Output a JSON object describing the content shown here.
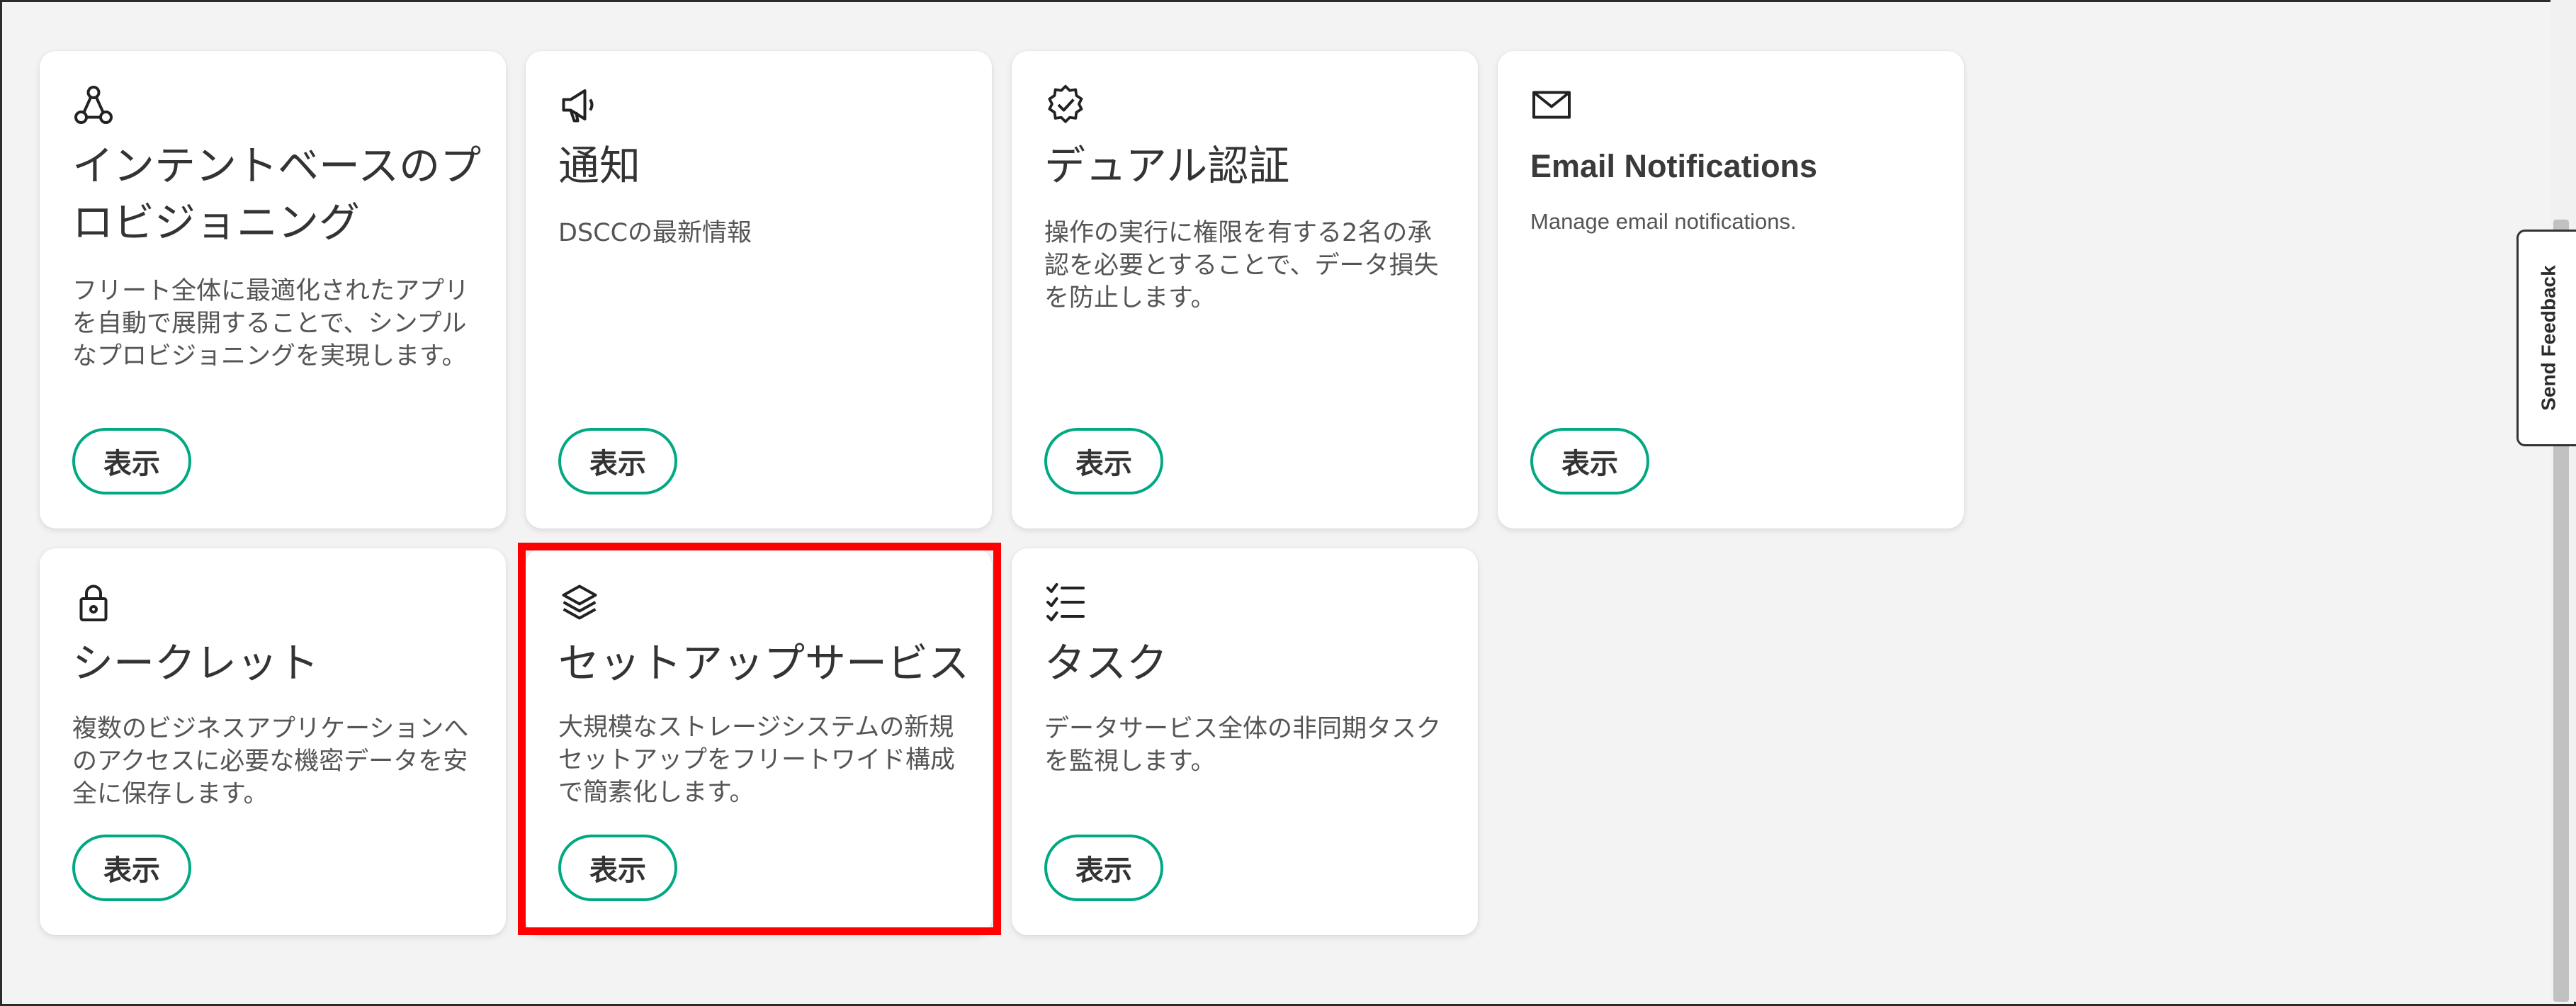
{
  "cards": [
    {
      "icon": "network-nodes-icon",
      "title": "インテントベースのプロビジョニング",
      "description": "フリート全体に最適化されたアプリを自動で展開することで、シンプルなプロビジョニングを実現します。",
      "button": "表示"
    },
    {
      "icon": "megaphone-icon",
      "title": "通知",
      "description": "DSCCの最新情報",
      "button": "表示"
    },
    {
      "icon": "verified-badge-icon",
      "title": "デュアル認証",
      "description": "操作の実行に権限を有する2名の承認を必要とすることで、データ損失を防止します。",
      "button": "表示"
    },
    {
      "icon": "mail-icon",
      "title": "Email Notifications",
      "description": "Manage email notifications.",
      "button": "表示"
    },
    {
      "icon": "lock-icon",
      "title": "シークレット",
      "description": "複数のビジネスアプリケーションへのアクセスに必要な機密データを安全に保存します。",
      "button": "表示"
    },
    {
      "icon": "layers-icon",
      "title": "セットアップサービス",
      "description": "大規模なストレージシステムの新規セットアップをフリートワイド構成で簡素化します。",
      "button": "表示"
    },
    {
      "icon": "task-list-icon",
      "title": "タスク",
      "description": "データサービス全体の非同期タスクを監視します。",
      "button": "表示"
    }
  ],
  "feedback_tab": "Send Feedback",
  "colors": {
    "button_border": "#01a982",
    "highlight": "#ff0000",
    "background": "#f3f3f3"
  }
}
